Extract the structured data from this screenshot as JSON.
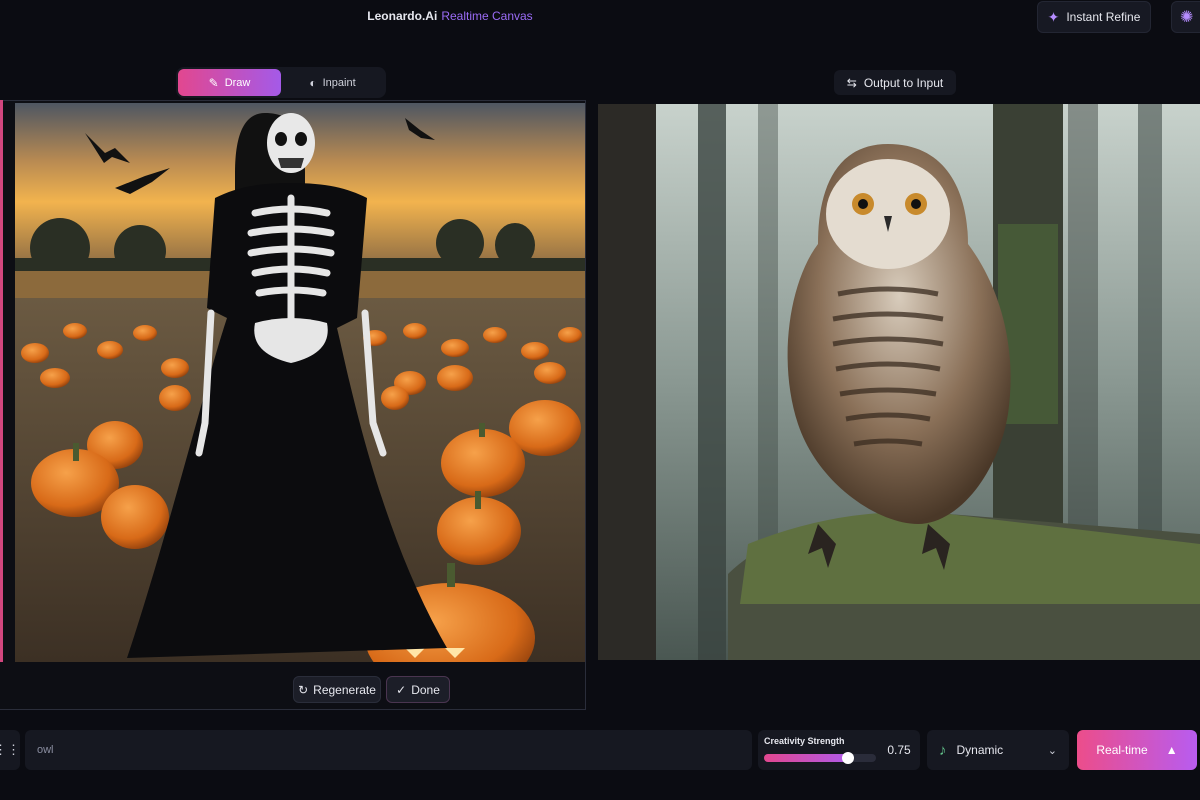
{
  "header": {
    "brand": "Leonardo.Ai",
    "subtitle": "Realtime Canvas",
    "instant_refine_label": "Instant Refine"
  },
  "tabs": [
    {
      "label": "Draw",
      "icon": "brush-icon",
      "active": true
    },
    {
      "label": "Inpaint",
      "icon": "palette-icon",
      "active": false
    }
  ],
  "output_to_input_label": "Output to Input",
  "canvas_actions": {
    "regenerate_label": "Regenerate",
    "done_label": "Done"
  },
  "prompt": {
    "placeholder": "owl",
    "value": ""
  },
  "creativity": {
    "label": "Creativity Strength",
    "value": "0.75",
    "level": 0.75
  },
  "style": {
    "selected": "Dynamic",
    "icon": "guitar-icon"
  },
  "realtime_label": "Real-time",
  "colors": {
    "accent_pink": "#e2478f",
    "accent_purple": "#a45ae8",
    "background": "#0b0c12",
    "panel": "#161821"
  }
}
